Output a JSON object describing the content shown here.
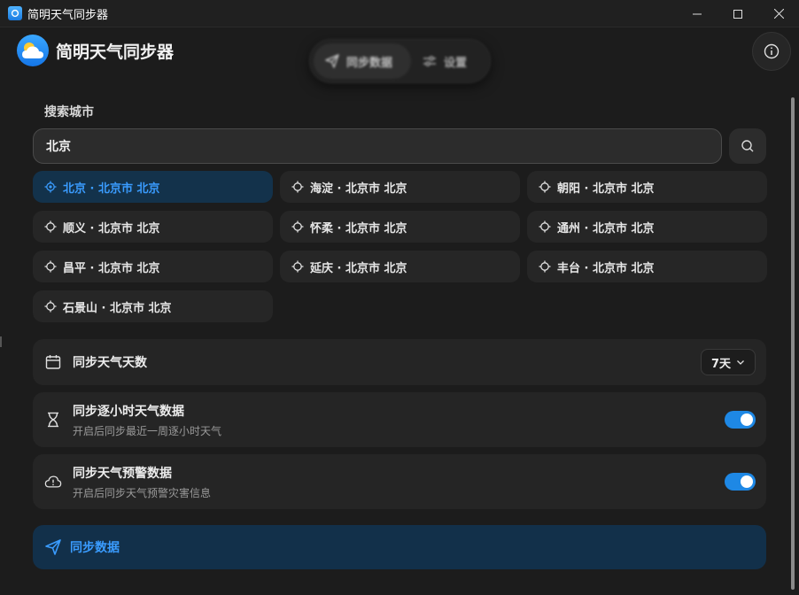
{
  "window": {
    "title": "简明天气同步器",
    "controls": [
      "minimize",
      "maximize",
      "close"
    ]
  },
  "header": {
    "app_name": "简明天气同步器",
    "nav": [
      {
        "label": "同步数据",
        "icon": "send-icon",
        "active": true
      },
      {
        "label": "设置",
        "icon": "sliders-icon",
        "active": false
      }
    ],
    "info_icon": "info-icon"
  },
  "search": {
    "section_label": "搜索城市",
    "value": "北京",
    "button_icon": "search-icon"
  },
  "cities": [
    {
      "label": "北京 · 北京市 北京",
      "selected": true
    },
    {
      "label": "海淀 · 北京市 北京",
      "selected": false
    },
    {
      "label": "朝阳 · 北京市 北京",
      "selected": false
    },
    {
      "label": "顺义 · 北京市 北京",
      "selected": false
    },
    {
      "label": "怀柔 · 北京市 北京",
      "selected": false
    },
    {
      "label": "通州 · 北京市 北京",
      "selected": false
    },
    {
      "label": "昌平 · 北京市 北京",
      "selected": false
    },
    {
      "label": "延庆 · 北京市 北京",
      "selected": false
    },
    {
      "label": "丰台 · 北京市 北京",
      "selected": false
    },
    {
      "label": "石景山 · 北京市 北京",
      "selected": false
    }
  ],
  "settings": {
    "days": {
      "title": "同步天气天数",
      "value": "7天",
      "icon": "calendar-icon"
    },
    "hourly": {
      "title": "同步逐小时天气数据",
      "subtitle": "开启后同步最近一周逐小时天气",
      "enabled": true,
      "icon": "hourglass-icon"
    },
    "alerts": {
      "title": "同步天气预警数据",
      "subtitle": "开启后同步天气预警灾害信息",
      "enabled": true,
      "icon": "cloud-alert-icon"
    }
  },
  "action": {
    "sync_label": "同步数据",
    "icon": "send-icon"
  },
  "colors": {
    "accent": "#3a9cff",
    "toggle_on": "#1e88e5",
    "selected_bg": "#13324b",
    "background": "#1c1c1c"
  }
}
